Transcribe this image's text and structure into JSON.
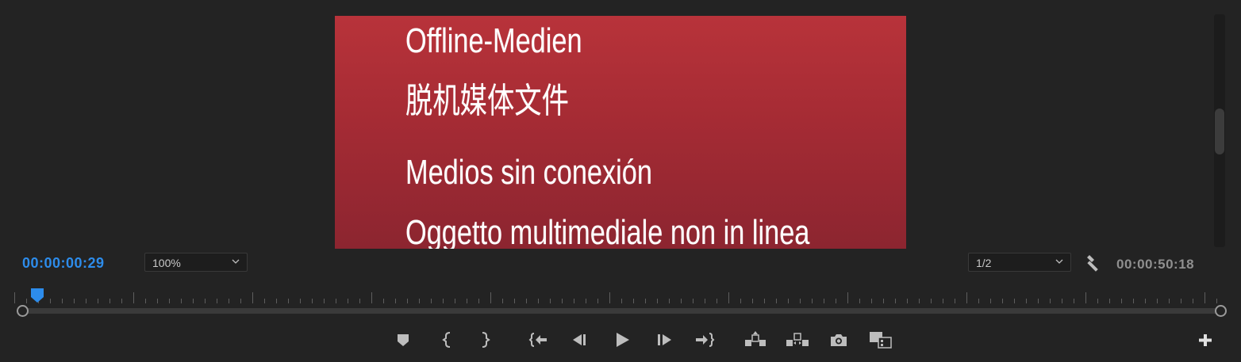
{
  "viewer": {
    "offline_lines": [
      "Offline-Medien",
      "脱机媒体文件",
      "Medios sin conexión",
      "Oggetto multimediale non in linea"
    ]
  },
  "info_bar": {
    "playhead_timecode": "00:00:00:29",
    "zoom_value": "100%",
    "resolution_value": "1/2",
    "duration_timecode": "00:00:50:18"
  },
  "controls": [
    {
      "name": "add-marker-button",
      "icon": "marker-icon"
    },
    {
      "name": "mark-in-button",
      "icon": "mark-in-icon"
    },
    {
      "name": "mark-out-button",
      "icon": "mark-out-icon"
    },
    {
      "name": "go-to-in-button",
      "icon": "go-to-in-icon"
    },
    {
      "name": "step-back-button",
      "icon": "step-back-icon"
    },
    {
      "name": "play-button",
      "icon": "play-icon"
    },
    {
      "name": "step-forward-button",
      "icon": "step-forward-icon"
    },
    {
      "name": "go-to-out-button",
      "icon": "go-to-out-icon"
    },
    {
      "name": "lift-button",
      "icon": "lift-icon"
    },
    {
      "name": "extract-button",
      "icon": "extract-icon"
    },
    {
      "name": "export-frame-button",
      "icon": "camera-icon"
    },
    {
      "name": "compare-view-button",
      "icon": "comparison-view-icon"
    },
    {
      "name": "button-editor-button",
      "icon": "plus-icon"
    }
  ],
  "colors": {
    "accent": "#2d8ceb",
    "background": "#232323",
    "offline_frame": "#a52b34",
    "icon": "#bdbdbd"
  }
}
